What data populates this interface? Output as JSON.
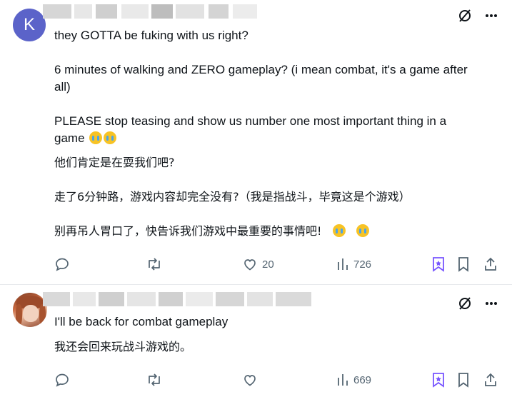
{
  "posts": [
    {
      "avatar_letter": "K",
      "lines": [
        "they GOTTA be fuking with us right?",
        "6 minutes of walking and ZERO gameplay? (i mean combat, it's a game after",
        "all)",
        "PLEASE stop teasing and show us number one most important thing in a",
        "game",
        "他们肯定是在耍我们吧?",
        "走了6分钟路，游戏内容却完全没有?（我是指战斗，毕竟这是个游戏）",
        "别再吊人胃口了，快告诉我们游戏中最重要的事情吧!"
      ],
      "stats": {
        "replies": "",
        "reposts": "",
        "likes": "20",
        "views": "726"
      }
    },
    {
      "lines": [
        "I'll be back for combat gameplay",
        "我还会回来玩战斗游戏的。"
      ],
      "stats": {
        "replies": "",
        "reposts": "",
        "likes": "",
        "views": "669"
      }
    }
  ],
  "icons": {
    "top": [
      "grok-icon",
      "more-icon"
    ],
    "actions": [
      "reply-icon",
      "repost-icon",
      "like-icon",
      "views-icon",
      "grok-bookmark-icon",
      "bookmark-icon",
      "share-icon"
    ]
  },
  "colors": {
    "avatar_bg": "#5b63c9",
    "accent": "#7856ff",
    "muted": "#536471"
  }
}
